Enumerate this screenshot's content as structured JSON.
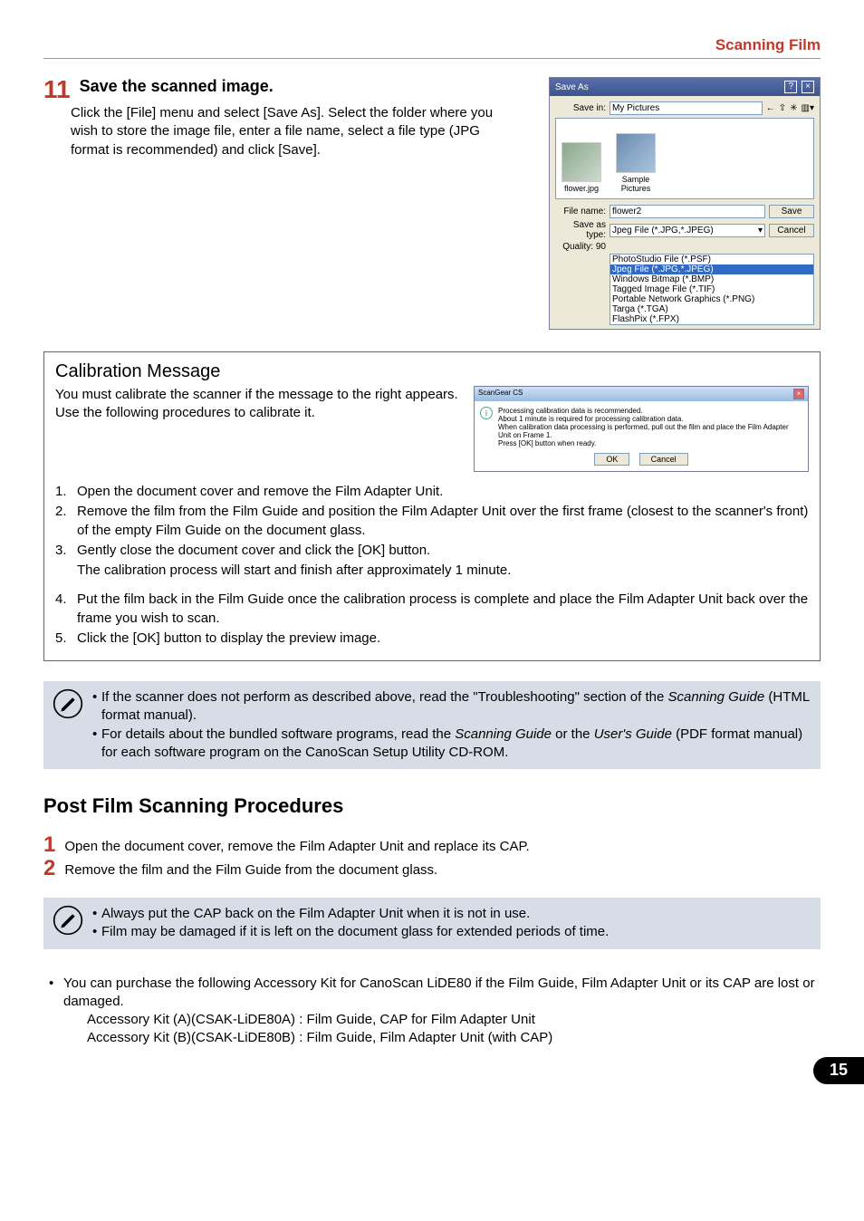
{
  "header": {
    "scanning_film": "Scanning Film"
  },
  "step11": {
    "num": "11",
    "title": "Save the scanned image.",
    "body": "Click the [File] menu and select [Save As]. Select the folder where you wish to store the image file, enter a file name, select a file type (JPG format is recommended) and click [Save]."
  },
  "saveas": {
    "title": "Save As",
    "savein_label": "Save in:",
    "savein_value": "My Pictures",
    "thumb1": "flower.jpg",
    "thumb2": "Sample Pictures",
    "filename_label": "File name:",
    "filename_value": "flower2",
    "saveas_label": "Save as type:",
    "saveas_value": "Jpeg File (*.JPG,*.JPEG)",
    "quality_label": "Quality: 90",
    "save_btn": "Save",
    "cancel_btn": "Cancel",
    "types": [
      "PhotoStudio File (*.PSF)",
      "Jpeg File (*.JPG,*.JPEG)",
      "Windows Bitmap (*.BMP)",
      "Tagged Image File (*.TIF)",
      "Portable Network Graphics (*.PNG)",
      "Targa (*.TGA)",
      "FlashPix (*.FPX)"
    ]
  },
  "calibration": {
    "title": "Calibration Message",
    "intro": "You must calibrate the scanner if the message to the right appears. Use the following procedures to calibrate it.",
    "dialog": {
      "title": "ScanGear CS",
      "line1": "Processing calibration data is recommended.",
      "line2": "About 1 minute is required for processing calibration data.",
      "line3": "When calibration data processing is performed, pull out the film and place the Film Adapter Unit on Frame 1.",
      "line4": "Press [OK] button when ready.",
      "ok": "OK",
      "cancel": "Cancel"
    },
    "steps": {
      "s1": "Open the document cover and remove the Film Adapter Unit.",
      "s2": "Remove the film from the Film Guide and position the Film Adapter Unit over the first frame (closest to the scanner's front) of the empty Film Guide on the document glass.",
      "s3": "Gently close the document cover and click the [OK] button.",
      "s3sub": "The calibration process will start and finish after approximately 1 minute.",
      "s4": "Put the film back in the Film Guide once the calibration process is complete and place the Film Adapter Unit back over the frame you wish to scan.",
      "s5": "Click the [OK] button to display the preview image."
    }
  },
  "note1": {
    "b1a": "If the scanner does not perform as described above, read the \"Troubleshooting\" section of the ",
    "b1b": "Scanning Guide",
    "b1c": " (HTML format manual).",
    "b2a": "For details about the bundled software programs, read the ",
    "b2b": "Scanning Guide",
    "b2c": " or the ",
    "b2d": "User's Guide",
    "b2e": " (PDF format manual) for each software program on the CanoScan Setup Utility CD-ROM."
  },
  "post": {
    "title": "Post Film Scanning Procedures",
    "s1num": "1",
    "s1": "Open the document cover, remove the Film Adapter Unit and replace its CAP.",
    "s2num": "2",
    "s2": "Remove the film and the Film Guide from the document glass."
  },
  "note2": {
    "b1": "Always put the CAP back on the Film Adapter Unit when it is not in use.",
    "b2": "Film may be damaged if it is left on the document glass for extended periods of time."
  },
  "accessory": {
    "intro": "You can purchase the following Accessory Kit for CanoScan LiDE80 if the Film Guide, Film Adapter Unit or its CAP are lost or damaged.",
    "kita": "Accessory Kit (A)(CSAK-LiDE80A) : Film Guide, CAP for Film Adapter Unit",
    "kitb": "Accessory Kit (B)(CSAK-LiDE80B) : Film Guide, Film Adapter Unit (with CAP)"
  },
  "pagenum": "15"
}
